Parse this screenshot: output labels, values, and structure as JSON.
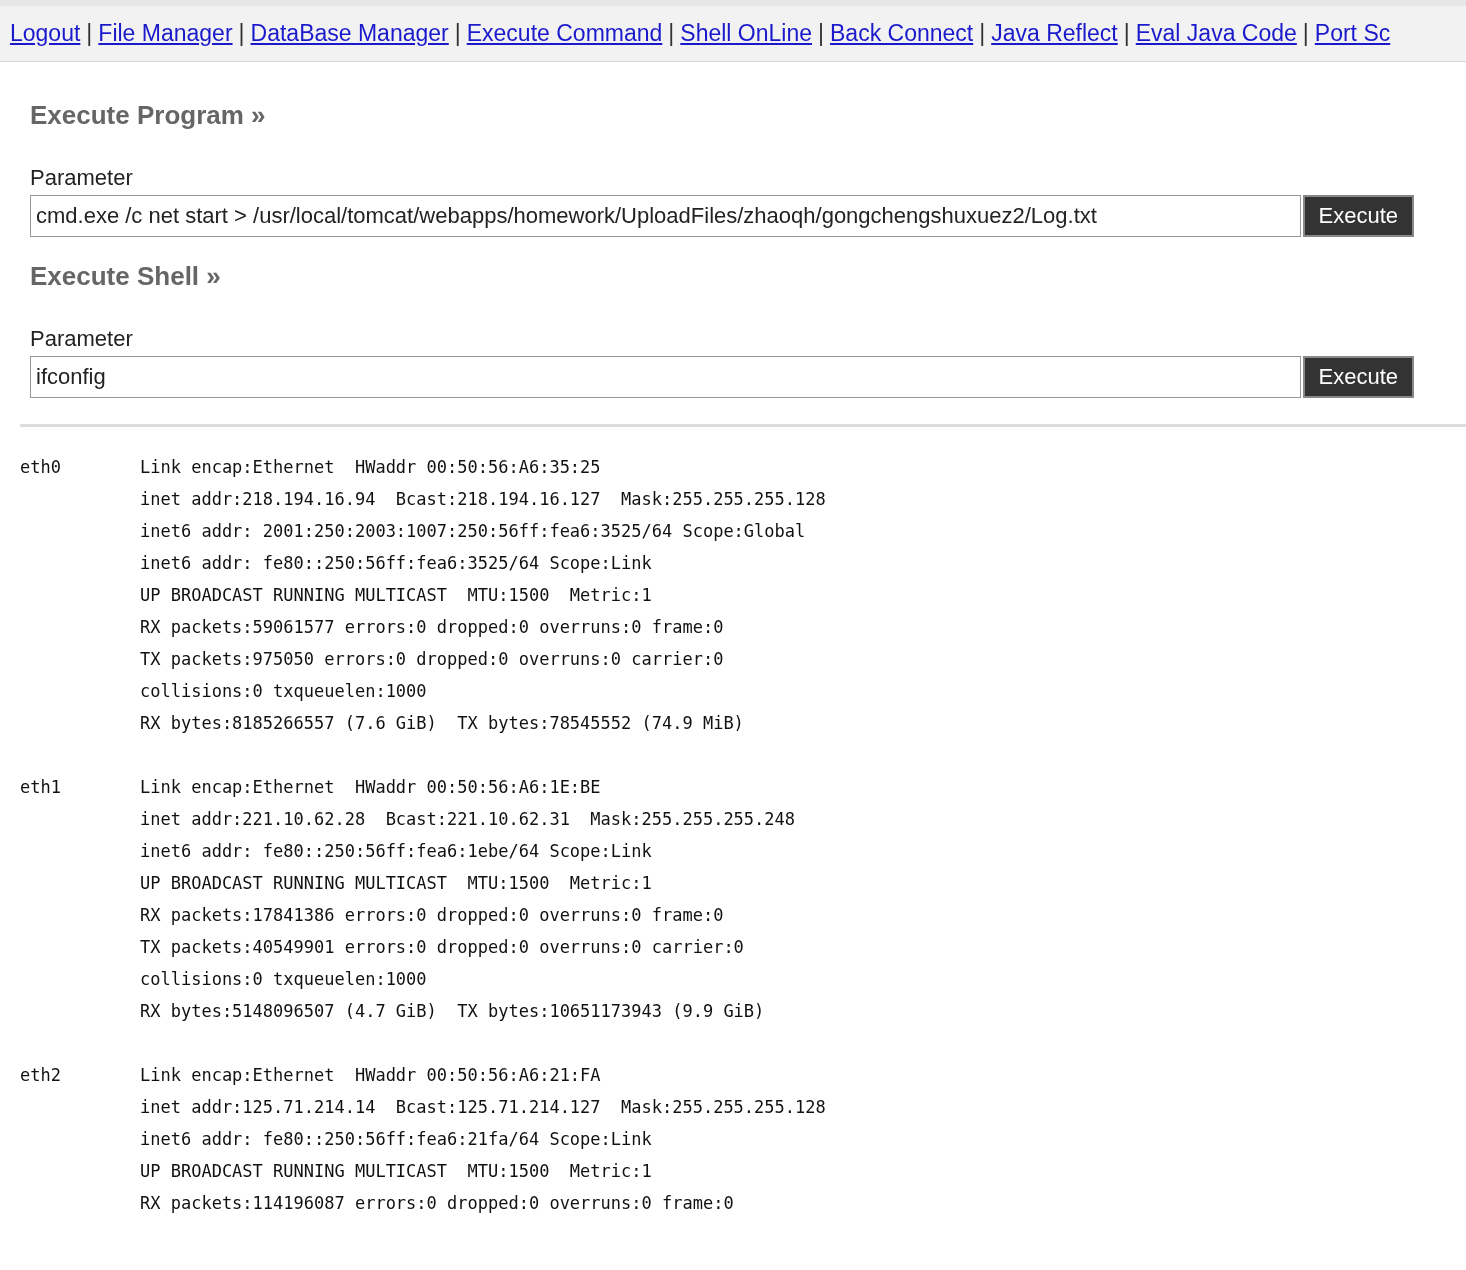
{
  "nav_links": [
    "Logout",
    "File Manager",
    "DataBase Manager",
    "Execute Command",
    "Shell OnLine",
    "Back Connect",
    "Java Reflect",
    "Eval Java Code",
    "Port Sc"
  ],
  "nav_separator": "|",
  "sections": [
    {
      "title": "Execute Program »",
      "label": "Parameter",
      "value": "cmd.exe /c net start > /usr/local/tomcat/webapps/homework/UploadFiles/zhaoqh/gongchengshuxuez2/Log.txt",
      "button": "Execute"
    },
    {
      "title": "Execute Shell »",
      "label": "Parameter",
      "value": "ifconfig",
      "button": "Execute"
    }
  ],
  "output": [
    {
      "name": "eth0",
      "lines": [
        "Link encap:Ethernet  HWaddr 00:50:56:A6:35:25",
        "inet addr:218.194.16.94  Bcast:218.194.16.127  Mask:255.255.255.128",
        "inet6 addr: 2001:250:2003:1007:250:56ff:fea6:3525/64 Scope:Global",
        "inet6 addr: fe80::250:56ff:fea6:3525/64 Scope:Link",
        "UP BROADCAST RUNNING MULTICAST  MTU:1500  Metric:1",
        "RX packets:59061577 errors:0 dropped:0 overruns:0 frame:0",
        "TX packets:975050 errors:0 dropped:0 overruns:0 carrier:0",
        "collisions:0 txqueuelen:1000",
        "RX bytes:8185266557 (7.6 GiB)  TX bytes:78545552 (74.9 MiB)"
      ]
    },
    {
      "name": "eth1",
      "lines": [
        "Link encap:Ethernet  HWaddr 00:50:56:A6:1E:BE",
        "inet addr:221.10.62.28  Bcast:221.10.62.31  Mask:255.255.255.248",
        "inet6 addr: fe80::250:56ff:fea6:1ebe/64 Scope:Link",
        "UP BROADCAST RUNNING MULTICAST  MTU:1500  Metric:1",
        "RX packets:17841386 errors:0 dropped:0 overruns:0 frame:0",
        "TX packets:40549901 errors:0 dropped:0 overruns:0 carrier:0",
        "collisions:0 txqueuelen:1000",
        "RX bytes:5148096507 (4.7 GiB)  TX bytes:10651173943 (9.9 GiB)"
      ]
    },
    {
      "name": "eth2",
      "lines": [
        "Link encap:Ethernet  HWaddr 00:50:56:A6:21:FA",
        "inet addr:125.71.214.14  Bcast:125.71.214.127  Mask:255.255.255.128",
        "inet6 addr: fe80::250:56ff:fea6:21fa/64 Scope:Link",
        "UP BROADCAST RUNNING MULTICAST  MTU:1500  Metric:1",
        "RX packets:114196087 errors:0 dropped:0 overruns:0 frame:0"
      ]
    }
  ]
}
